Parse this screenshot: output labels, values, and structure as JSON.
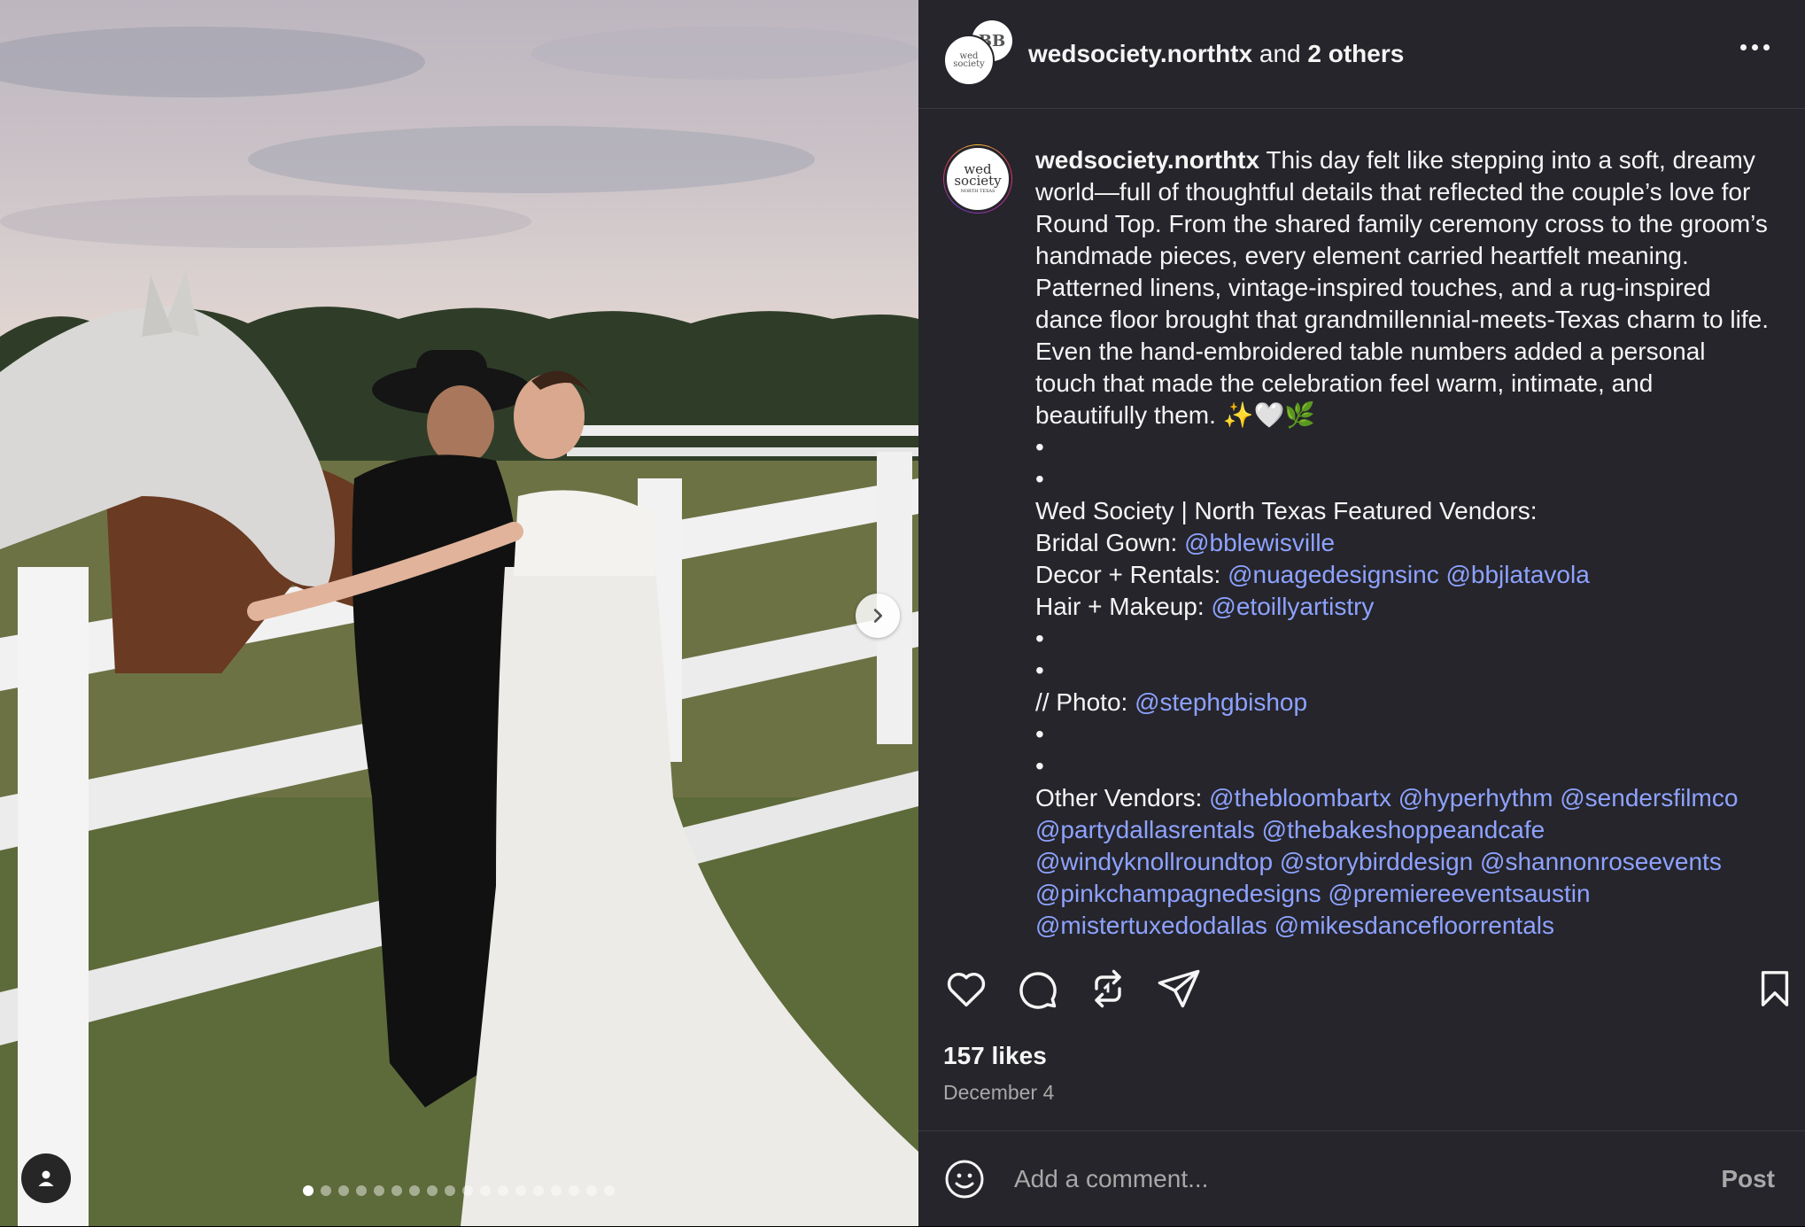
{
  "header": {
    "username": "wedsociety.northtx",
    "and_text": " and ",
    "others": "2 others"
  },
  "caption": {
    "username": "wedsociety.northtx",
    "body": " This day felt like stepping into a soft, dreamy world—full of thoughtful details that reflected the couple’s love for Round Top. From the shared family ceremony cross to the groom’s handmade pieces, every element carried heartfelt meaning. Patterned linens, vintage-inspired touches, and a rug-inspired dance floor brought that grandmillennial-meets-Texas charm to life. Even the hand-embroidered table numbers added a personal touch that made the celebration feel warm, intimate, and beautifully them. ✨🤍🌿",
    "dot": "•",
    "vendors_heading": "Wed Society | North Texas Featured Vendors:",
    "bridal_label": "Bridal Gown: ",
    "bridal_link": "@bblewisville",
    "decor_label": "Decor + Rentals: ",
    "decor_link_1": "@nuagedesignsinc",
    "decor_link_2": "@bbjlatavola",
    "hair_label": "Hair + Makeup: ",
    "hair_link": "@etoillyartistry",
    "photo_label": "// Photo: ",
    "photo_link": "@stephgbishop",
    "other_label": "Other Vendors: ",
    "other_links": [
      "@thebloombartx",
      "@hyperhythm",
      "@sendersfilmco",
      "@partydallasrentals",
      "@thebakeshoppeandcafe",
      "@windyknollroundtop",
      "@storybirddesign",
      "@shannonroseevents",
      "@pinkchampagnedesigns",
      "@premiereeventsaustin",
      "@mistertuxedodallas",
      "@mikesdancefloorrentals"
    ]
  },
  "stats": {
    "likes": "157 likes",
    "date": "December 4"
  },
  "comment": {
    "placeholder": "Add a comment...",
    "post_label": "Post"
  },
  "avatar_text": {
    "wed": "wed",
    "society": "society",
    "region": "NORTH TEXAS",
    "back_initials": "BB"
  },
  "carousel": {
    "total_slides": 18,
    "active_index": 0
  },
  "icons": [
    "heart-icon",
    "comment-icon",
    "repost-icon",
    "share-icon",
    "bookmark-icon",
    "more-icon",
    "emoji-icon",
    "chevron-right-icon",
    "user-tag-icon"
  ],
  "colors": {
    "link": "#8ea2ff",
    "panel_bg": "#25252b",
    "text": "#f5f5f5",
    "muted": "#a8a8a8"
  }
}
